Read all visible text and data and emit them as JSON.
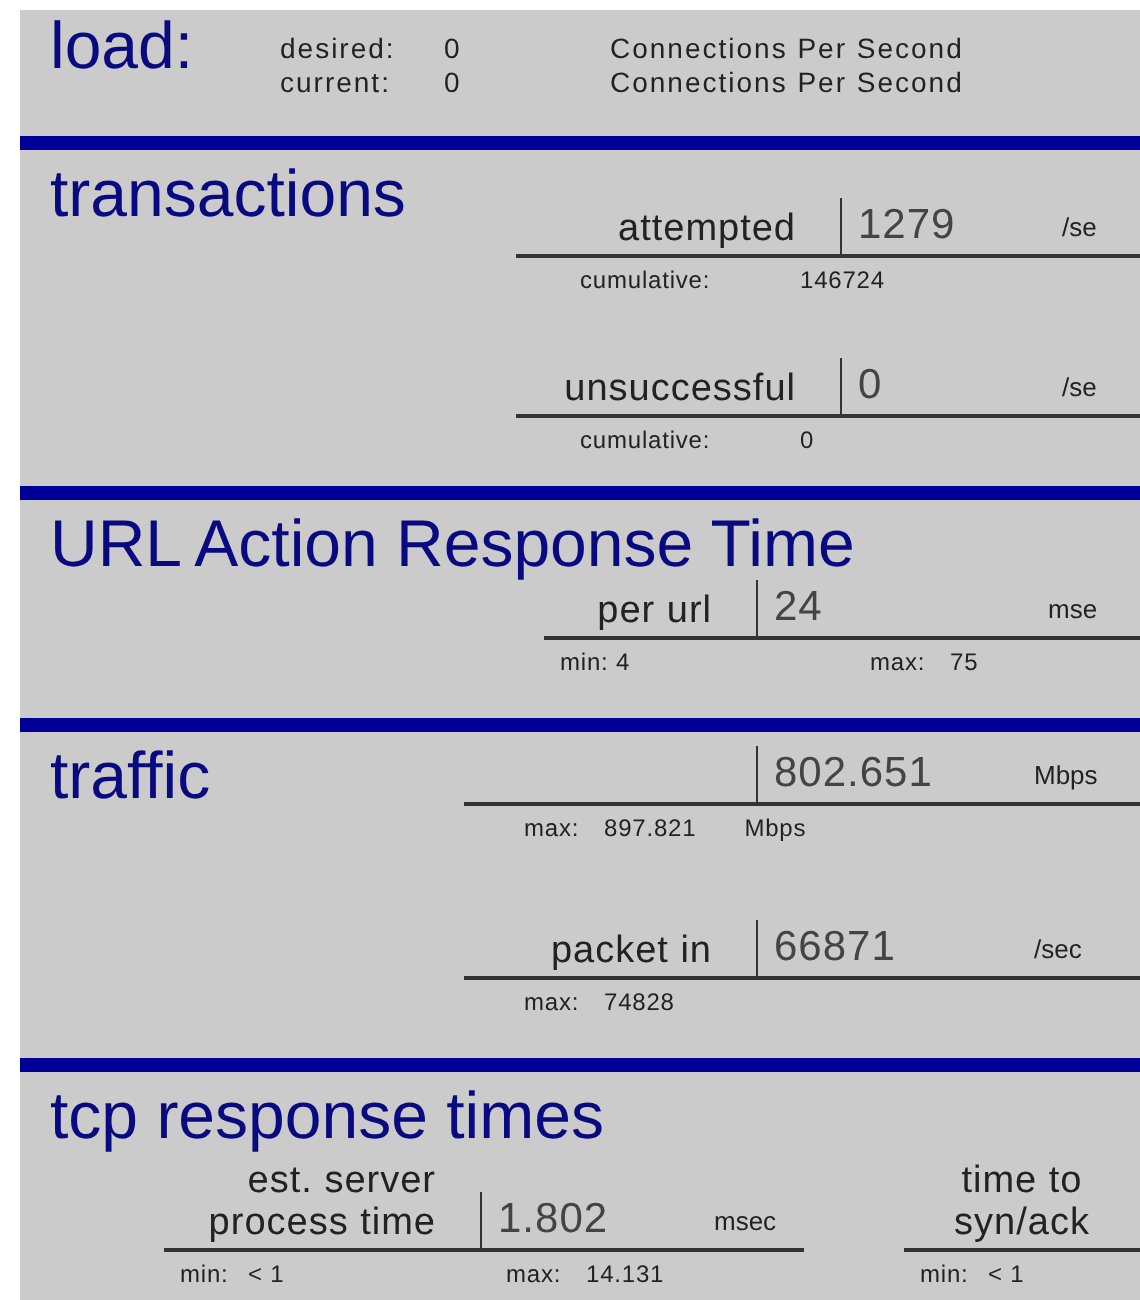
{
  "load": {
    "title": "load:",
    "rows": [
      {
        "label": "desired:",
        "value": "0",
        "unit": "Connections Per Second"
      },
      {
        "label": "current:",
        "value": "0",
        "unit": "Connections Per Second"
      }
    ]
  },
  "sections": [
    {
      "title": "transactions",
      "metrics": [
        {
          "label": "attempted",
          "value": "1279",
          "unit": "/se",
          "stats": [
            {
              "label": "cumulative:",
              "value": "146724"
            }
          ]
        },
        {
          "label": "unsuccessful",
          "value": "0",
          "unit": "/se",
          "stats": [
            {
              "label": "cumulative:",
              "value": "0"
            }
          ]
        }
      ]
    },
    {
      "title": "URL Action Response Time",
      "metrics": [
        {
          "label": "per url",
          "value": "24",
          "unit": "mse",
          "stats": [
            {
              "label": "min:",
              "value": "4"
            },
            {
              "label": "max:",
              "value": "75"
            }
          ]
        }
      ]
    },
    {
      "title": "traffic",
      "metrics": [
        {
          "value": "802.651",
          "unit": "Mbps",
          "stats": [
            {
              "label": "max:",
              "value": "897.821",
              "unit": "Mbps"
            }
          ]
        },
        {
          "label": "packet in",
          "value": "66871",
          "unit": "/sec",
          "stats": [
            {
              "label": "max:",
              "value": "74828"
            }
          ]
        }
      ]
    },
    {
      "title": "tcp response times",
      "metrics": [
        {
          "label": "est. server process time",
          "value": "1.802",
          "unit": "msec",
          "stats": [
            {
              "label": "min:",
              "value": "< 1"
            },
            {
              "label": "max:",
              "value": "14.131"
            }
          ]
        },
        {
          "label": "time to syn/ack",
          "stats": [
            {
              "label": "min:",
              "value": "< 1"
            }
          ]
        }
      ]
    }
  ]
}
